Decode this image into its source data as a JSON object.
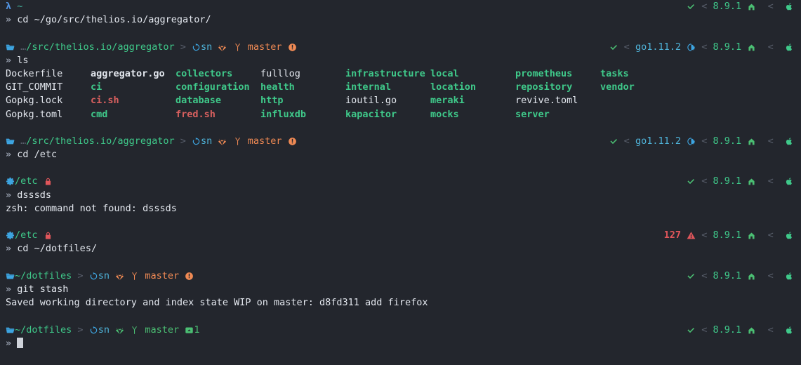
{
  "terminal": {
    "background": "#23262d",
    "foreground": "#d8dee9",
    "prompt_char": "»",
    "chevron": "<",
    "separator": ">"
  },
  "blocks": [
    {
      "id": "block-1",
      "prompt": {
        "type": "lambda",
        "symbol": "λ",
        "path": "~"
      },
      "status": {
        "exit_ok": true,
        "exit_code": "",
        "items": [
          "8.9.1"
        ],
        "node_version": "8.9.1",
        "go_version": "",
        "show_go": false
      },
      "command": "cd ~/go/src/thelios.io/aggregator/",
      "output": []
    },
    {
      "id": "block-2",
      "prompt": {
        "type": "git",
        "path": "…/src/thelios.io/aggregator",
        "remote_label": "sn",
        "branch": "master",
        "dirty": true,
        "stash_count": "",
        "clean": false
      },
      "status": {
        "exit_ok": true,
        "exit_code": "",
        "go_version": "go1.11.2",
        "node_version": "8.9.1",
        "show_go": true
      },
      "command": "ls",
      "output": []
    },
    {
      "id": "block-3",
      "prompt": {
        "type": "git",
        "path": "…/src/thelios.io/aggregator",
        "remote_label": "sn",
        "branch": "master",
        "dirty": true,
        "stash_count": "",
        "clean": false
      },
      "status": {
        "exit_ok": true,
        "exit_code": "",
        "go_version": "go1.11.2",
        "node_version": "8.9.1",
        "show_go": true
      },
      "command": "cd /etc",
      "output": []
    },
    {
      "id": "block-4",
      "prompt": {
        "type": "system",
        "path": "/etc",
        "locked": true
      },
      "status": {
        "exit_ok": true,
        "exit_code": "",
        "node_version": "8.9.1",
        "show_go": false
      },
      "command": "dsssds",
      "output": [
        "zsh: command not found: dsssds"
      ]
    },
    {
      "id": "block-5",
      "prompt": {
        "type": "system",
        "path": "/etc",
        "locked": true
      },
      "status": {
        "exit_ok": false,
        "exit_code": "127",
        "node_version": "8.9.1",
        "show_go": false
      },
      "command": "cd ~/dotfiles/",
      "output": []
    },
    {
      "id": "block-6",
      "prompt": {
        "type": "git",
        "path": "~/dotfiles",
        "remote_label": "sn",
        "branch": "master",
        "dirty": true,
        "stash_count": "",
        "clean": false
      },
      "status": {
        "exit_ok": true,
        "exit_code": "",
        "node_version": "8.9.1",
        "show_go": false
      },
      "command": "git stash",
      "output": [
        "Saved working directory and index state WIP on master: d8fd311 add firefox"
      ]
    },
    {
      "id": "block-7",
      "prompt": {
        "type": "git",
        "path": "~/dotfiles",
        "remote_label": "sn",
        "branch": "master",
        "dirty": false,
        "stash_count": "1",
        "clean": true
      },
      "status": {
        "exit_ok": true,
        "exit_code": "",
        "node_version": "8.9.1",
        "show_go": false
      },
      "command": "",
      "output": []
    }
  ],
  "ls_listing": {
    "columns": 8,
    "rows": [
      [
        {
          "name": "Dockerfile",
          "kind": "file"
        },
        {
          "name": "aggregator.go",
          "kind": "file-bold"
        },
        {
          "name": "collectors",
          "kind": "dir"
        },
        {
          "name": "fulllog",
          "kind": "file"
        },
        {
          "name": "infrastructure",
          "kind": "dir"
        },
        {
          "name": "local",
          "kind": "dir"
        },
        {
          "name": "prometheus",
          "kind": "dir"
        },
        {
          "name": "tasks",
          "kind": "dir"
        }
      ],
      [
        {
          "name": "GIT_COMMIT",
          "kind": "file"
        },
        {
          "name": "ci",
          "kind": "dir"
        },
        {
          "name": "configuration",
          "kind": "dir"
        },
        {
          "name": "health",
          "kind": "dir"
        },
        {
          "name": "internal",
          "kind": "dir"
        },
        {
          "name": "location",
          "kind": "dir"
        },
        {
          "name": "repository",
          "kind": "dir"
        },
        {
          "name": "vendor",
          "kind": "dir"
        }
      ],
      [
        {
          "name": "Gopkg.lock",
          "kind": "file"
        },
        {
          "name": "ci.sh",
          "kind": "exec"
        },
        {
          "name": "database",
          "kind": "dir"
        },
        {
          "name": "http",
          "kind": "dir"
        },
        {
          "name": "ioutil.go",
          "kind": "file"
        },
        {
          "name": "meraki",
          "kind": "dir"
        },
        {
          "name": "revive.toml",
          "kind": "file"
        },
        {
          "name": "",
          "kind": "file"
        }
      ],
      [
        {
          "name": "Gopkg.toml",
          "kind": "file"
        },
        {
          "name": "cmd",
          "kind": "dir"
        },
        {
          "name": "fred.sh",
          "kind": "exec"
        },
        {
          "name": "influxdb",
          "kind": "dir"
        },
        {
          "name": "kapacitor",
          "kind": "dir"
        },
        {
          "name": "mocks",
          "kind": "dir"
        },
        {
          "name": "server",
          "kind": "dir"
        },
        {
          "name": "",
          "kind": "file"
        }
      ]
    ]
  },
  "icons": {
    "folder": "folder-icon",
    "gear": "gear-icon",
    "lock": "lock-icon",
    "sync": "sync-icon",
    "gitlab": "gitlab-fox-icon",
    "branch": "git-branch-icon",
    "alert": "alert-badge-icon",
    "stash": "stash-box-icon",
    "check": "check-icon",
    "warning": "warning-triangle-icon",
    "go": "go-gopher-icon",
    "node": "node-home-icon",
    "apple": "apple-icon"
  },
  "colors": {
    "green": "#3fc98a",
    "blue": "#5294e2",
    "orange": "#f08a54",
    "red": "#e0565b",
    "gray": "#585e6b",
    "white": "#e3e7ee"
  }
}
